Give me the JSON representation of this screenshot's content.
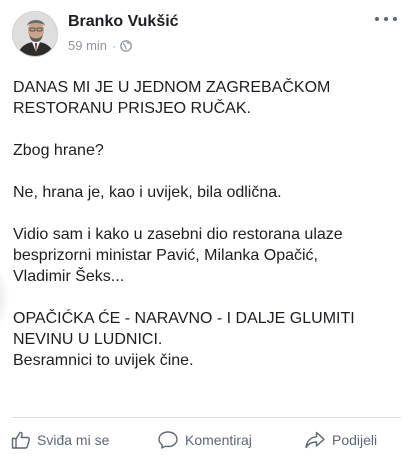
{
  "post": {
    "author": "Branko Vukšić",
    "time": "59 min",
    "separator": "·",
    "audience_icon": "globe-icon",
    "more_icon": "more-options-icon",
    "paragraphs": [
      "DANAS MI JE U JEDNOM ZAGREBAČKOM\nRESTORANU PRISJEO RUČAK.",
      "Zbog hrane?",
      "Ne, hrana je, kao i uvijek, bila odlična.",
      "Vidio sam i kako u zasebni dio restorana ulaze\nbesprizorni ministar Pavić, Milanka Opačić,\nVladimir Šeks...",
      "OPAČIĆKA ĆE - NARAVNO - I DALJE GLUMITI\nNEVINU U LUDNICI.\nBesramnici to uvijek čine."
    ]
  },
  "actions": {
    "like": "Sviđa mi se",
    "comment": "Komentiraj",
    "share": "Podijeli"
  },
  "colors": {
    "text": "#1c1e21",
    "meta": "#90949c",
    "action": "#606770",
    "divider": "#dadde1"
  }
}
